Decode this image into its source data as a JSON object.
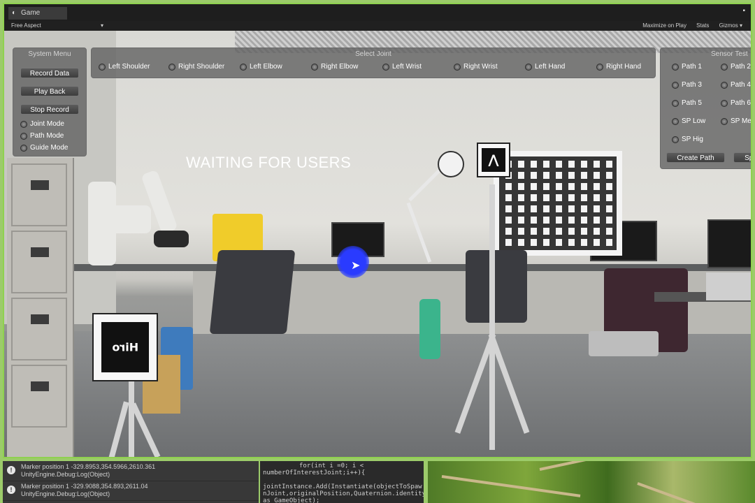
{
  "window": {
    "tab_title": "Game",
    "tab_icon": "unity-icon",
    "maximize_glyph": "▪"
  },
  "toolbar": {
    "aspect": "Free Aspect",
    "aspect_caret": "▾",
    "maximize_on_play": "Maximize on Play",
    "stats": "Stats",
    "gizmos": "Gizmos ▾"
  },
  "scene": {
    "status_text": "WAITING FOR USERS",
    "marker_left_text": "Hiro",
    "marker_right_glyph": "⋀"
  },
  "system_menu": {
    "title": "System Menu",
    "buttons": [
      "Record Data",
      "Play Back",
      "Stop Record"
    ],
    "modes": [
      "Joint Mode",
      "Path Mode",
      "Guide Mode"
    ]
  },
  "select_joint": {
    "title": "Select Joint",
    "options": [
      "Left Shoulder",
      "Right Shoulder",
      "Left Elbow",
      "Right Elbow",
      "Left Wrist",
      "Right Wrist",
      "Left Hand",
      "Right Hand"
    ]
  },
  "sensor_test": {
    "title": "Sensor Test",
    "options": [
      "Path 1",
      "Path 2",
      "Path 3",
      "Path 4",
      "Path 5",
      "Path 6",
      "SP Low",
      "SP Med",
      "SP Hig"
    ],
    "buttons": [
      "Create Path",
      "Spe"
    ]
  },
  "console": {
    "logs": [
      {
        "line1": "Marker position 1 -329.8953,354.5966,2610.361",
        "line2": "UnityEngine.Debug:Log(Object)"
      },
      {
        "line1": "Marker position 1 -329.9088,354.893,2611.04",
        "line2": "UnityEngine.Debug:Log(Object)"
      }
    ]
  },
  "code": {
    "lines": [
      "for(int i =0; i <",
      "numberOfInterestJoint;i++){",
      "",
      "jointInstance.Add(Instantiate(objectToSpaw",
      "nJoint,originalPosition,Quaternion.identity)",
      "as GameObject);"
    ]
  }
}
